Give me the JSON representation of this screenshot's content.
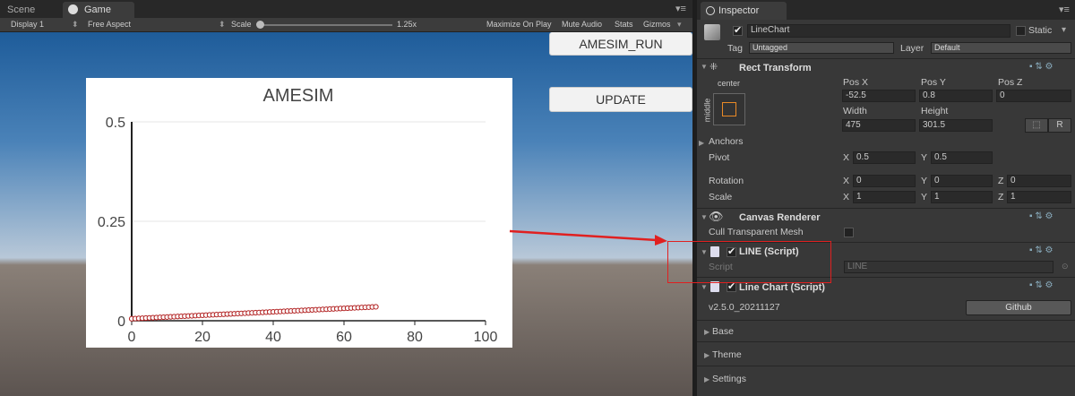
{
  "game_window": {
    "tabs": {
      "scene": "Scene",
      "game": "Game"
    },
    "toolbar": {
      "display": "Display 1",
      "aspect": "Free Aspect",
      "scale_label": "Scale",
      "scale_value": "1.25x",
      "maximize": "Maximize On Play",
      "mute": "Mute Audio",
      "stats": "Stats",
      "gizmos": "Gizmos"
    },
    "buttons": {
      "run": "AMESIM_RUN",
      "update": "UPDATE"
    }
  },
  "chart_data": {
    "type": "scatter",
    "title": "AMESIM",
    "xlim": [
      0,
      100
    ],
    "ylim": [
      0,
      0.5
    ],
    "x_ticks": [
      "0",
      "20",
      "40",
      "60",
      "80",
      "100"
    ],
    "y_ticks": [
      "0",
      "0.25",
      "0.5"
    ],
    "grid": "horizontal",
    "series": [
      {
        "color": "#b22222",
        "marker": "open-circle",
        "x_start": 0,
        "x_end": 69,
        "y_start": 0.005,
        "y_end": 0.035
      }
    ]
  },
  "inspector": {
    "tab": "Inspector",
    "object_name": "LineChart",
    "static_label": "Static",
    "tag_label": "Tag",
    "tag_value": "Untagged",
    "layer_label": "Layer",
    "layer_value": "Default",
    "rect_transform": {
      "title": "Rect Transform",
      "anchor_h": "center",
      "anchor_v": "middle",
      "pos_x_label": "Pos X",
      "pos_y_label": "Pos Y",
      "pos_z_label": "Pos Z",
      "pos_x": "-52.5",
      "pos_y": "0.8",
      "pos_z": "0",
      "width_label": "Width",
      "height_label": "Height",
      "width": "475",
      "height": "301.5",
      "r_label": "R",
      "anchors": "Anchors",
      "pivot": "Pivot",
      "pivot_x": "0.5",
      "pivot_y": "0.5",
      "rotation": "Rotation",
      "rot_x": "0",
      "rot_y": "0",
      "rot_z": "0",
      "scale": "Scale",
      "scale_x": "1",
      "scale_y": "1",
      "scale_z": "1",
      "x": "X",
      "y": "Y",
      "z": "Z"
    },
    "canvas_renderer": {
      "title": "Canvas Renderer",
      "cull": "Cull Transparent Mesh"
    },
    "line_script": {
      "title": "LINE (Script)",
      "script_label": "Script",
      "script_value": "LINE"
    },
    "line_chart_script": {
      "title": "Line Chart (Script)",
      "version": "v2.5.0_20211127",
      "github": "Github"
    },
    "sections": [
      "Base",
      "Theme",
      "Settings"
    ]
  }
}
